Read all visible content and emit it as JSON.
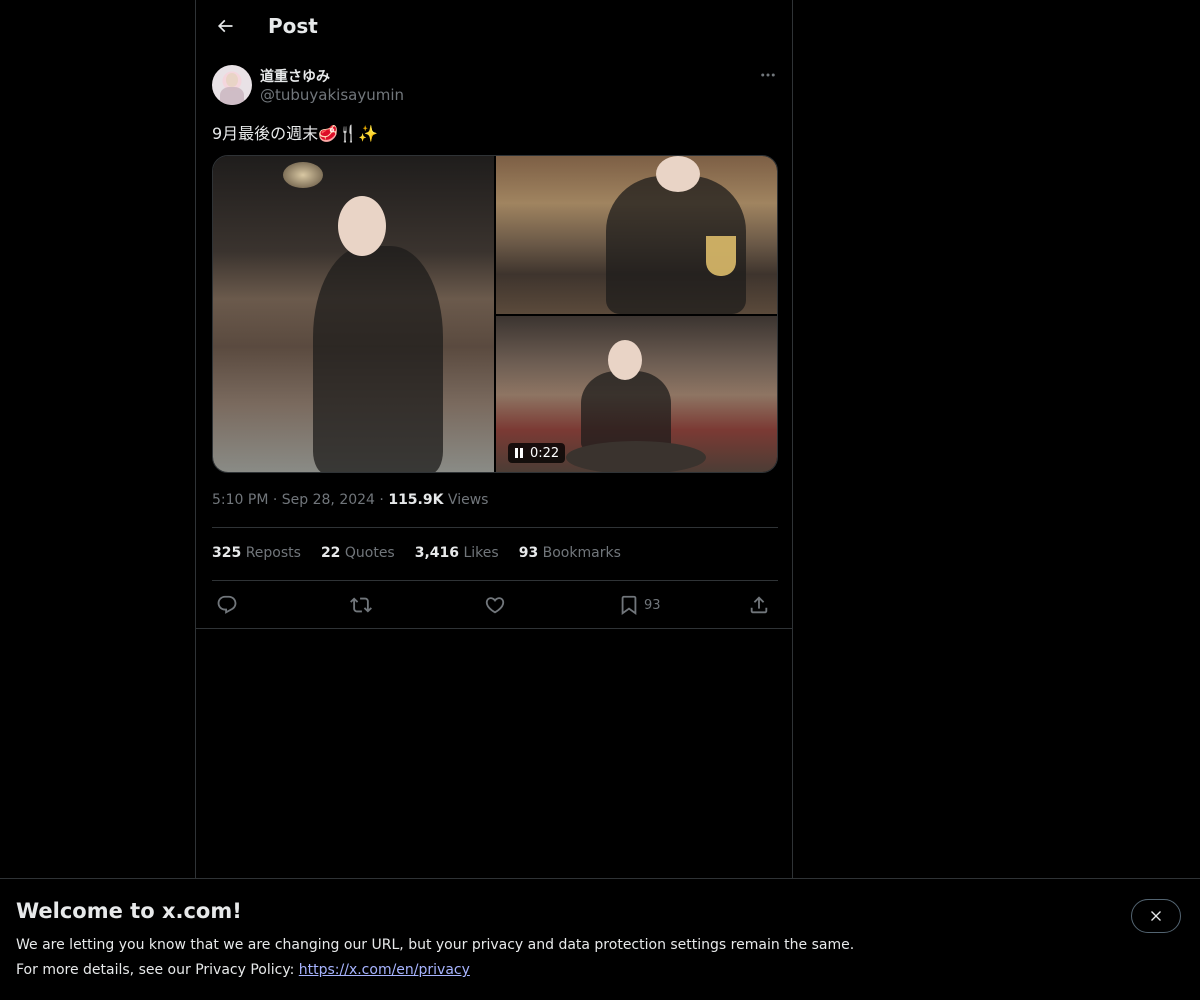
{
  "topbar": {
    "title": "Post"
  },
  "author": {
    "display_name": "道重さゆみ",
    "handle": "@tubuyakisayumin"
  },
  "tweet": {
    "text": "9月最後の週末",
    "emojis": "🥩🍴✨"
  },
  "media": {
    "video_duration": "0:22"
  },
  "meta": {
    "time": "5:10 PM",
    "separator": "·",
    "date": "Sep 28, 2024",
    "views_count": "115.9K",
    "views_label": "Views"
  },
  "stats": [
    {
      "count": "325",
      "label": "Repost"
    },
    {
      "count": "22",
      "label": "Quotes"
    },
    {
      "count": "3,416",
      "label": "Likes"
    },
    {
      "count": "93",
      "label": "Bookmarks"
    }
  ],
  "stats_extra": {
    "repost_suffix": "s"
  },
  "actions": {
    "bookmark_count": "93"
  },
  "banner": {
    "title": "Welcome to x.com!",
    "line1": "We are letting you know that we are changing our URL, but your privacy and data protection settings remain the same.",
    "line2_prefix": "For more details, see our Privacy Policy:",
    "link": "https://x.com/en/privacy"
  },
  "colors": {
    "background": "#000000",
    "text": "#e7e9ea",
    "muted": "#71767b",
    "border": "#2f3336",
    "link": "#a7b4ff"
  },
  "icons": [
    "back-arrow-icon",
    "more-icon",
    "pause-icon",
    "reply-icon",
    "repost-icon",
    "like-icon",
    "bookmark-icon",
    "share-icon",
    "close-icon"
  ]
}
